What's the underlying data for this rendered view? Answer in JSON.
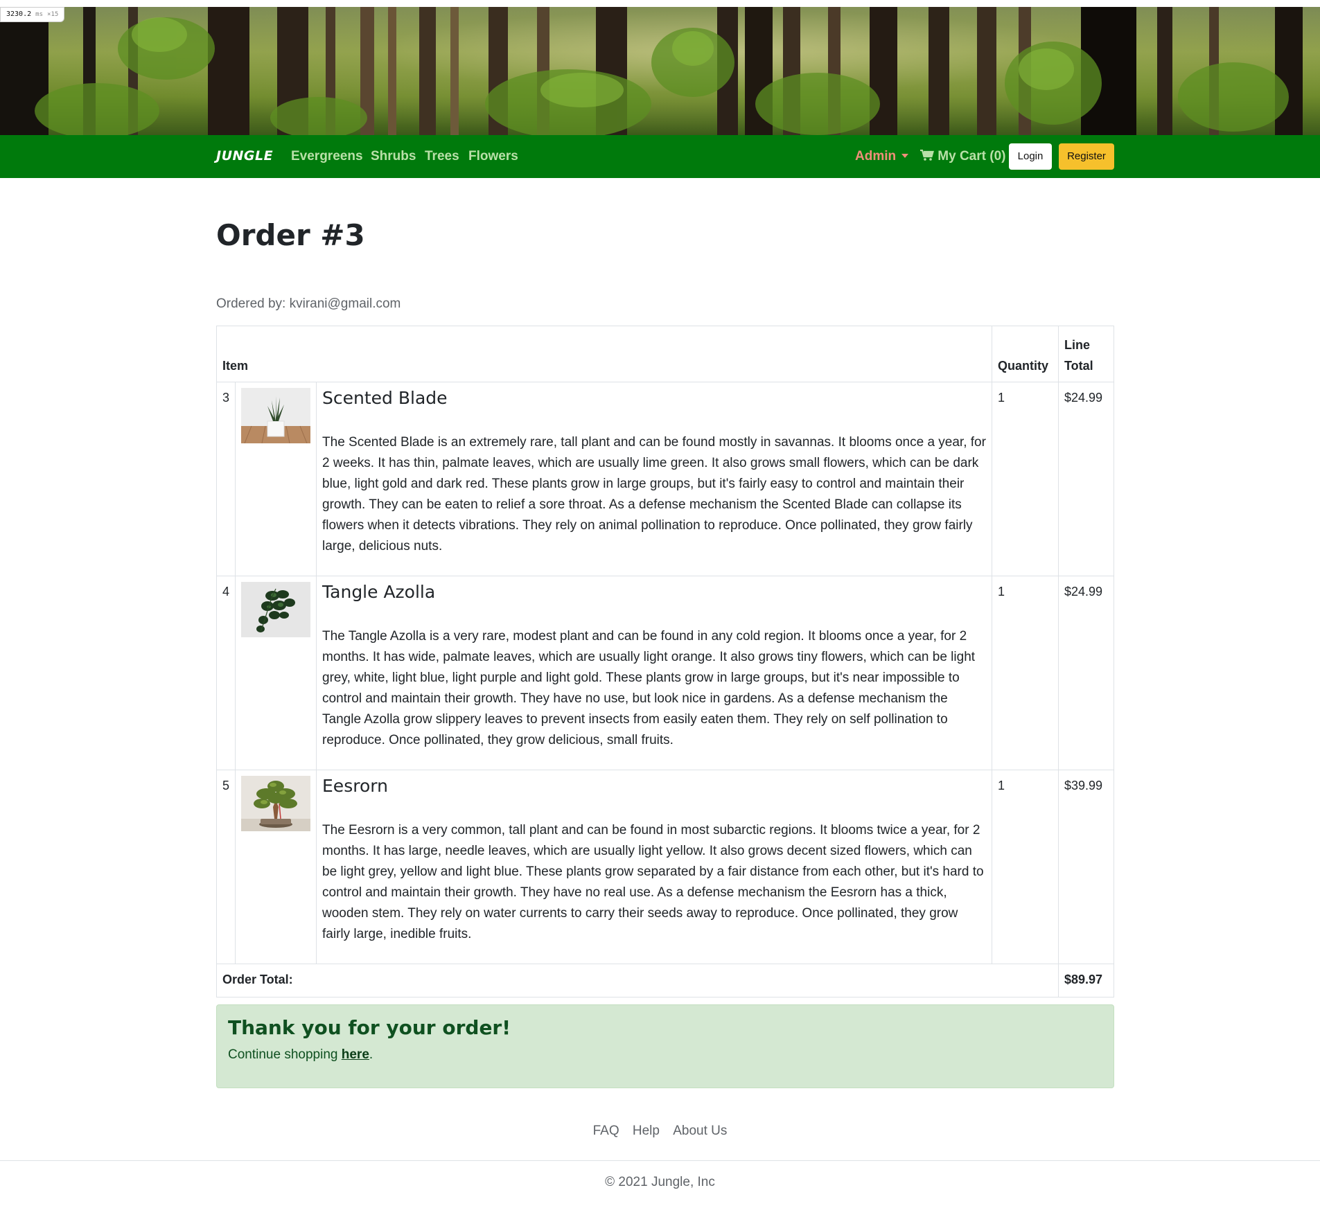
{
  "perf": {
    "value": "3230.2",
    "unit": "ms",
    "mult": "×15"
  },
  "navbar": {
    "brand": "JUNGLE",
    "links": [
      "Evergreens",
      "Shrubs",
      "Trees",
      "Flowers"
    ],
    "admin_label": "Admin",
    "cart_label": "My Cart (0)",
    "login_label": "Login",
    "register_label": "Register",
    "colors": {
      "bar": "#007a0c",
      "register": "#f6c02c"
    }
  },
  "order": {
    "title": "Order #3",
    "ordered_by": "Ordered by: kvirani@gmail.com",
    "headers": {
      "item": "Item",
      "quantity": "Quantity",
      "line_total": "Line Total"
    },
    "items": [
      {
        "index": "3",
        "image_icon": "snake-plant-photo",
        "name": "Scented Blade",
        "description": "The Scented Blade is an extremely rare, tall plant and can be found mostly in savannas. It blooms once a year, for 2 weeks. It has thin, palmate leaves, which are usually lime green. It also grows small flowers, which can be dark blue, light gold and dark red. These plants grow in large groups, but it's fairly easy to control and maintain their growth. They can be eaten to relief a sore throat. As a defense mechanism the Scented Blade can collapse its flowers when it detects vibrations. They rely on animal pollination to reproduce. Once pollinated, they grow fairly large, delicious nuts.",
        "quantity": "1",
        "line_total": "$24.99"
      },
      {
        "index": "4",
        "image_icon": "pothos-plant-photo",
        "name": "Tangle Azolla",
        "description": "The Tangle Azolla is a very rare, modest plant and can be found in any cold region. It blooms once a year, for 2 months. It has wide, palmate leaves, which are usually light orange. It also grows tiny flowers, which can be light grey, white, light blue, light purple and light gold. These plants grow in large groups, but it's near impossible to control and maintain their growth. They have no use, but look nice in gardens. As a defense mechanism the Tangle Azolla grow slippery leaves to prevent insects from easily eaten them. They rely on self pollination to reproduce. Once pollinated, they grow delicious, small fruits.",
        "quantity": "1",
        "line_total": "$24.99"
      },
      {
        "index": "5",
        "image_icon": "bonsai-tree-photo",
        "name": "Eesrorn",
        "description": "The Eesrorn is a very common, tall plant and can be found in most subarctic regions. It blooms twice a year, for 2 months. It has large, needle leaves, which are usually light yellow. It also grows decent sized flowers, which can be light grey, yellow and light blue. These plants grow separated by a fair distance from each other, but it's hard to control and maintain their growth. They have no real use. As a defense mechanism the Eesrorn has a thick, wooden stem. They rely on water currents to carry their seeds away to reproduce. Once pollinated, they grow fairly large, inedible fruits.",
        "quantity": "1",
        "line_total": "$39.99"
      }
    ],
    "total_label": "Order Total:",
    "total_value": "$89.97"
  },
  "alert": {
    "title": "Thank you for your order!",
    "text_before": "Continue shopping ",
    "link_text": "here",
    "text_after": ".",
    "color": "#d4e8d2"
  },
  "footer": {
    "links": [
      "FAQ",
      "Help",
      "About Us"
    ],
    "copyright": "© 2021 Jungle, Inc"
  }
}
